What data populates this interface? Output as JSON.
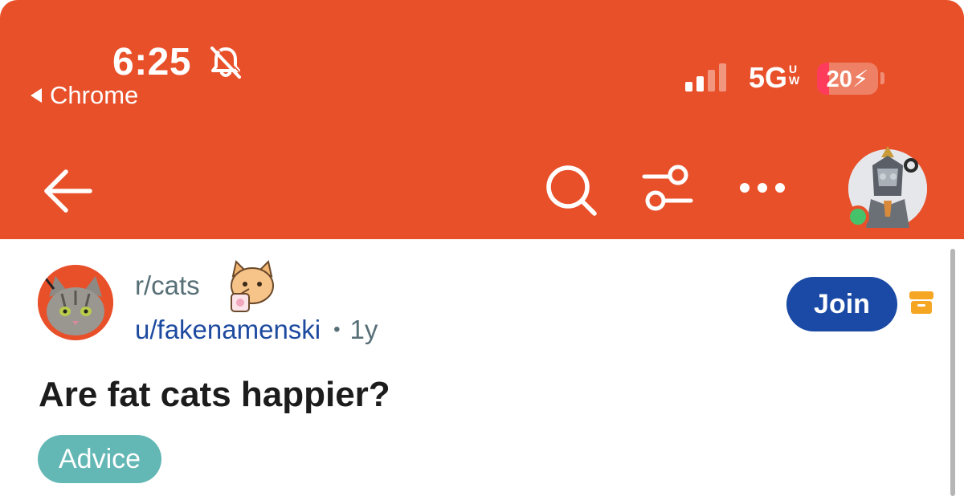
{
  "status_bar": {
    "time": "6:25",
    "back_app": "Chrome",
    "network": "5G",
    "network_sup_top": "U",
    "network_sup_bottom": "W",
    "battery_level": "20",
    "battery_fraction": 0.2,
    "signal_bars_active": 2,
    "signal_bars_total": 4
  },
  "colors": {
    "header": "#e8502a",
    "join_button": "#1a4aa5",
    "flair": "#63b7b5",
    "archive_icon": "#f5a623",
    "online": "#46c36a"
  },
  "toolbar": {
    "icons": [
      "back-arrow-icon",
      "search-icon",
      "filter-icon",
      "more-icon",
      "user-avatar"
    ]
  },
  "post": {
    "subreddit": "r/cats",
    "author": "u/fakenamenski",
    "separator": "•",
    "age": "1y",
    "join_label": "Join",
    "title": "Are fat cats happier?",
    "flair": "Advice"
  }
}
